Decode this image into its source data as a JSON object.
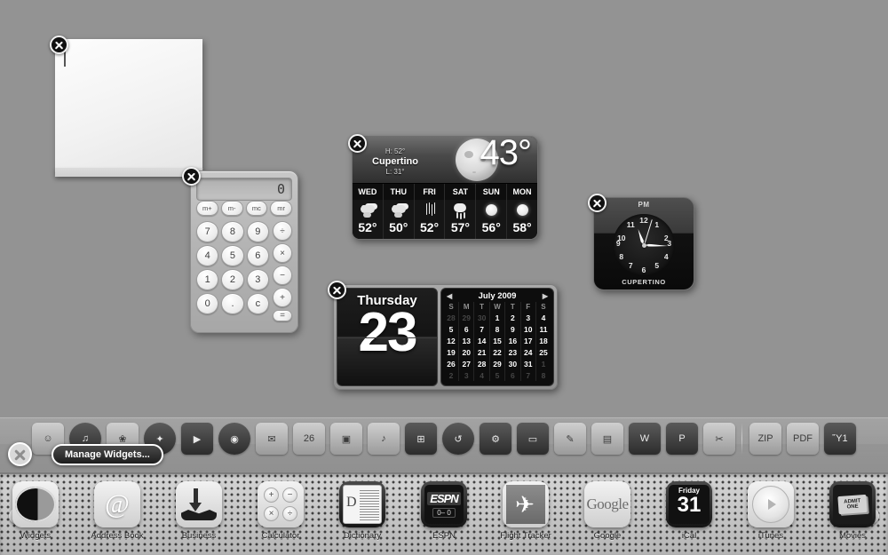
{
  "desktop": {
    "background_color": "#939393"
  },
  "stickies": {
    "name": "Stickies",
    "text": "",
    "close_label": "close"
  },
  "calculator": {
    "name": "Calculator",
    "display": "0",
    "memory_keys": [
      "m+",
      "m-",
      "mc",
      "mr"
    ],
    "number_keys": [
      "7",
      "8",
      "9",
      "4",
      "5",
      "6",
      "1",
      "2",
      "3",
      "0",
      ".",
      "c"
    ],
    "op_keys": [
      "÷",
      "×",
      "−",
      "+",
      "="
    ]
  },
  "weather": {
    "name": "Weather",
    "city": "Cupertino",
    "high": "H: 52°",
    "low": "L: 31°",
    "current_temp": "43°",
    "condition_icon": "moon-icon",
    "forecast": [
      {
        "day": "WED",
        "icon": "cloud-icon",
        "temp": "52°"
      },
      {
        "day": "THU",
        "icon": "cloud-icon",
        "temp": "50°"
      },
      {
        "day": "FRI",
        "icon": "rain-icon",
        "temp": "52°"
      },
      {
        "day": "SAT",
        "icon": "showers-icon",
        "temp": "57°"
      },
      {
        "day": "SUN",
        "icon": "sun-icon",
        "temp": "56°"
      },
      {
        "day": "MON",
        "icon": "sun-icon",
        "temp": "58°"
      }
    ]
  },
  "clock": {
    "name": "World Clock",
    "meridiem": "PM",
    "city": "CUPERTINO",
    "time": "11:15",
    "hour_deg": 341,
    "minute_deg": 92,
    "second_deg": 17,
    "hour_numerals": [
      "12",
      "1",
      "2",
      "3",
      "4",
      "5",
      "6",
      "7",
      "8",
      "9",
      "10",
      "11"
    ]
  },
  "calendar": {
    "name": "iCal",
    "weekday": "Thursday",
    "day": "23",
    "month_year": "July 2009",
    "prev_arrow": "◀",
    "next_arrow": "▶",
    "weekday_headers": [
      "S",
      "M",
      "T",
      "W",
      "T",
      "F",
      "S"
    ],
    "weeks": [
      [
        {
          "d": "28",
          "dim": true
        },
        {
          "d": "29",
          "dim": true
        },
        {
          "d": "30",
          "dim": true
        },
        {
          "d": "1"
        },
        {
          "d": "2"
        },
        {
          "d": "3"
        },
        {
          "d": "4"
        }
      ],
      [
        {
          "d": "5"
        },
        {
          "d": "6"
        },
        {
          "d": "7"
        },
        {
          "d": "8"
        },
        {
          "d": "9"
        },
        {
          "d": "10"
        },
        {
          "d": "11"
        }
      ],
      [
        {
          "d": "12"
        },
        {
          "d": "13"
        },
        {
          "d": "14"
        },
        {
          "d": "15"
        },
        {
          "d": "16"
        },
        {
          "d": "17"
        },
        {
          "d": "18"
        }
      ],
      [
        {
          "d": "19"
        },
        {
          "d": "20"
        },
        {
          "d": "21"
        },
        {
          "d": "22"
        },
        {
          "d": "23",
          "today": true
        },
        {
          "d": "24"
        },
        {
          "d": "25"
        }
      ],
      [
        {
          "d": "26"
        },
        {
          "d": "27"
        },
        {
          "d": "28"
        },
        {
          "d": "29"
        },
        {
          "d": "30"
        },
        {
          "d": "31"
        },
        {
          "d": "1",
          "dim": true
        }
      ],
      [
        {
          "d": "2",
          "dim": true
        },
        {
          "d": "3",
          "dim": true
        },
        {
          "d": "4",
          "dim": true
        },
        {
          "d": "5",
          "dim": true
        },
        {
          "d": "6",
          "dim": true
        },
        {
          "d": "7",
          "dim": true
        },
        {
          "d": "8",
          "dim": true
        }
      ]
    ]
  },
  "dock": {
    "items": [
      {
        "name": "finder",
        "glyph": "☺",
        "dark": false
      },
      {
        "name": "itunes-dock",
        "glyph": "♫",
        "dark": true
      },
      {
        "name": "iphoto-dock",
        "glyph": "❀",
        "dark": false
      },
      {
        "name": "safari",
        "glyph": "✦",
        "dark": true
      },
      {
        "name": "ichat",
        "glyph": "▶",
        "dark": true
      },
      {
        "name": "dvd-player",
        "glyph": "◉",
        "dark": true
      },
      {
        "name": "mail",
        "glyph": "✉",
        "dark": false
      },
      {
        "name": "ical-dock",
        "glyph": "26",
        "dark": false
      },
      {
        "name": "iphoto2",
        "glyph": "▣",
        "dark": false
      },
      {
        "name": "itunes2",
        "glyph": "♪",
        "dark": false
      },
      {
        "name": "spaces",
        "glyph": "⊞",
        "dark": true
      },
      {
        "name": "time-machine",
        "glyph": "↺",
        "dark": true
      },
      {
        "name": "system-preferences",
        "glyph": "⚙",
        "dark": true
      },
      {
        "name": "keynote",
        "glyph": "▭",
        "dark": true
      },
      {
        "name": "pages",
        "glyph": "✎",
        "dark": false
      },
      {
        "name": "numbers",
        "glyph": "▤",
        "dark": false
      },
      {
        "name": "word",
        "glyph": "W",
        "dark": true
      },
      {
        "name": "powerpoint",
        "glyph": "P",
        "dark": true
      },
      {
        "name": "excel",
        "glyph": "✂",
        "dark": false
      },
      {
        "name": "zip-file",
        "glyph": "ZIP",
        "dark": false
      },
      {
        "name": "pdf-file",
        "glyph": "PDF",
        "dark": false
      },
      {
        "name": "trash",
        "glyph": "Ὕ1",
        "dark": true
      }
    ]
  },
  "manage_bar": {
    "close_label": "Close Dashboard",
    "manage_button": "Manage Widgets..."
  },
  "widget_bar": {
    "prev_arrow": "←",
    "next_arrow": "→",
    "items": [
      {
        "label": "Widgets",
        "icon": "widgets-icon"
      },
      {
        "label": "Address Book",
        "icon": "address-book-icon"
      },
      {
        "label": "Business",
        "icon": "business-icon"
      },
      {
        "label": "Calculator",
        "icon": "calculator-icon"
      },
      {
        "label": "Dictionary",
        "icon": "dictionary-icon"
      },
      {
        "label": "ESPN",
        "icon": "espn-icon"
      },
      {
        "label": "Flight Tracker",
        "icon": "flight-tracker-icon"
      },
      {
        "label": "Google",
        "icon": "google-icon"
      },
      {
        "label": "iCal",
        "icon": "ical-icon"
      },
      {
        "label": "iTunes",
        "icon": "itunes-icon"
      },
      {
        "label": "Movies",
        "icon": "movies-icon"
      }
    ],
    "ical_icon_weekday": "Friday",
    "ical_icon_day": "31",
    "espn_logo": "ESPN",
    "espn_score": "0– 0",
    "google_logo": "Google",
    "movies_ticket": "ADMIT ONE",
    "dictionary_letter": "D",
    "calculator_icon_keys": [
      "+",
      "−",
      "×",
      "÷"
    ]
  }
}
